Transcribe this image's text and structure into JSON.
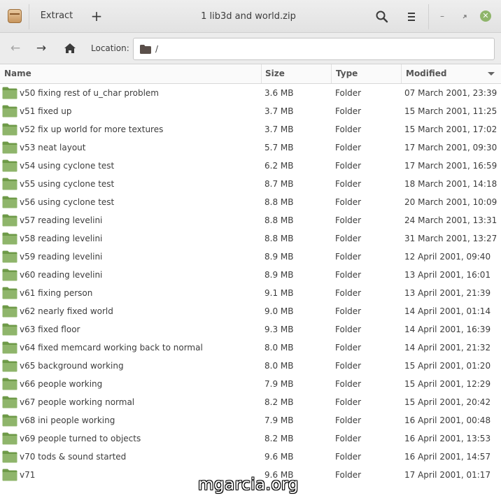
{
  "titlebar": {
    "extract_label": "Extract",
    "add_label": "+",
    "title": "1 lib3d and world.zip",
    "icons": {
      "app": "archive-box-icon",
      "search": "search-icon",
      "menu": "hamburger-menu-icon",
      "minimize": "minimize-icon",
      "maximize": "maximize-icon",
      "close": "close-icon"
    }
  },
  "location_bar": {
    "label": "Location:",
    "path": "/"
  },
  "columns": {
    "name": "Name",
    "size": "Size",
    "type": "Type",
    "modified": "Modified",
    "sort_column": "Modified",
    "sort_direction": "descending"
  },
  "files": [
    {
      "name": "v50 fixing rest of u_char problem",
      "size": "3.6 MB",
      "type": "Folder",
      "modified": "07 March 2001, 23:39"
    },
    {
      "name": "v51 fixed up",
      "size": "3.7 MB",
      "type": "Folder",
      "modified": "15 March 2001, 11:25"
    },
    {
      "name": "v52 fix up world for more textures",
      "size": "3.7 MB",
      "type": "Folder",
      "modified": "15 March 2001, 17:02"
    },
    {
      "name": "v53 neat layout",
      "size": "5.7 MB",
      "type": "Folder",
      "modified": "17 March 2001, 09:30"
    },
    {
      "name": "v54 using cyclone test",
      "size": "6.2 MB",
      "type": "Folder",
      "modified": "17 March 2001, 16:59"
    },
    {
      "name": "v55 using cyclone test",
      "size": "8.7 MB",
      "type": "Folder",
      "modified": "18 March 2001, 14:18"
    },
    {
      "name": "v56 using cyclone test",
      "size": "8.8 MB",
      "type": "Folder",
      "modified": "20 March 2001, 10:09"
    },
    {
      "name": "v57 reading levelini",
      "size": "8.8 MB",
      "type": "Folder",
      "modified": "24 March 2001, 13:31"
    },
    {
      "name": "v58 reading levelini",
      "size": "8.8 MB",
      "type": "Folder",
      "modified": "31 March 2001, 13:27"
    },
    {
      "name": "v59 reading levelini",
      "size": "8.9 MB",
      "type": "Folder",
      "modified": "12 April 2001, 09:40"
    },
    {
      "name": "v60 reading levelini",
      "size": "8.9 MB",
      "type": "Folder",
      "modified": "13 April 2001, 16:01"
    },
    {
      "name": "v61 fixing person",
      "size": "9.1 MB",
      "type": "Folder",
      "modified": "13 April 2001, 21:39"
    },
    {
      "name": "v62 nearly fixed world",
      "size": "9.0 MB",
      "type": "Folder",
      "modified": "14 April 2001, 01:14"
    },
    {
      "name": "v63 fixed floor",
      "size": "9.3 MB",
      "type": "Folder",
      "modified": "14 April 2001, 16:39"
    },
    {
      "name": "v64 fixed memcard working back to normal",
      "size": "8.0 MB",
      "type": "Folder",
      "modified": "14 April 2001, 21:32"
    },
    {
      "name": "v65 background working",
      "size": "8.0 MB",
      "type": "Folder",
      "modified": "15 April 2001, 01:20"
    },
    {
      "name": "v66 people working",
      "size": "7.9 MB",
      "type": "Folder",
      "modified": "15 April 2001, 12:29"
    },
    {
      "name": "v67 people working normal",
      "size": "8.2 MB",
      "type": "Folder",
      "modified": "15 April 2001, 20:42"
    },
    {
      "name": "v68 ini people working",
      "size": "7.9 MB",
      "type": "Folder",
      "modified": "16 April 2001, 00:48"
    },
    {
      "name": "v69 people turned to objects",
      "size": "8.2 MB",
      "type": "Folder",
      "modified": "16 April 2001, 13:53"
    },
    {
      "name": "v70 tods & sound started",
      "size": "9.6 MB",
      "type": "Folder",
      "modified": "16 April 2001, 14:57"
    },
    {
      "name": "v71",
      "size": "9.6 MB",
      "type": "Folder",
      "modified": "17 April 2001, 01:17"
    }
  ],
  "watermark": "mgarcia.org",
  "colors": {
    "folder_icon": "#8fb56b",
    "folder_icon_dark": "#6e9a48",
    "location_folder_icon": "#5a4f4a"
  }
}
